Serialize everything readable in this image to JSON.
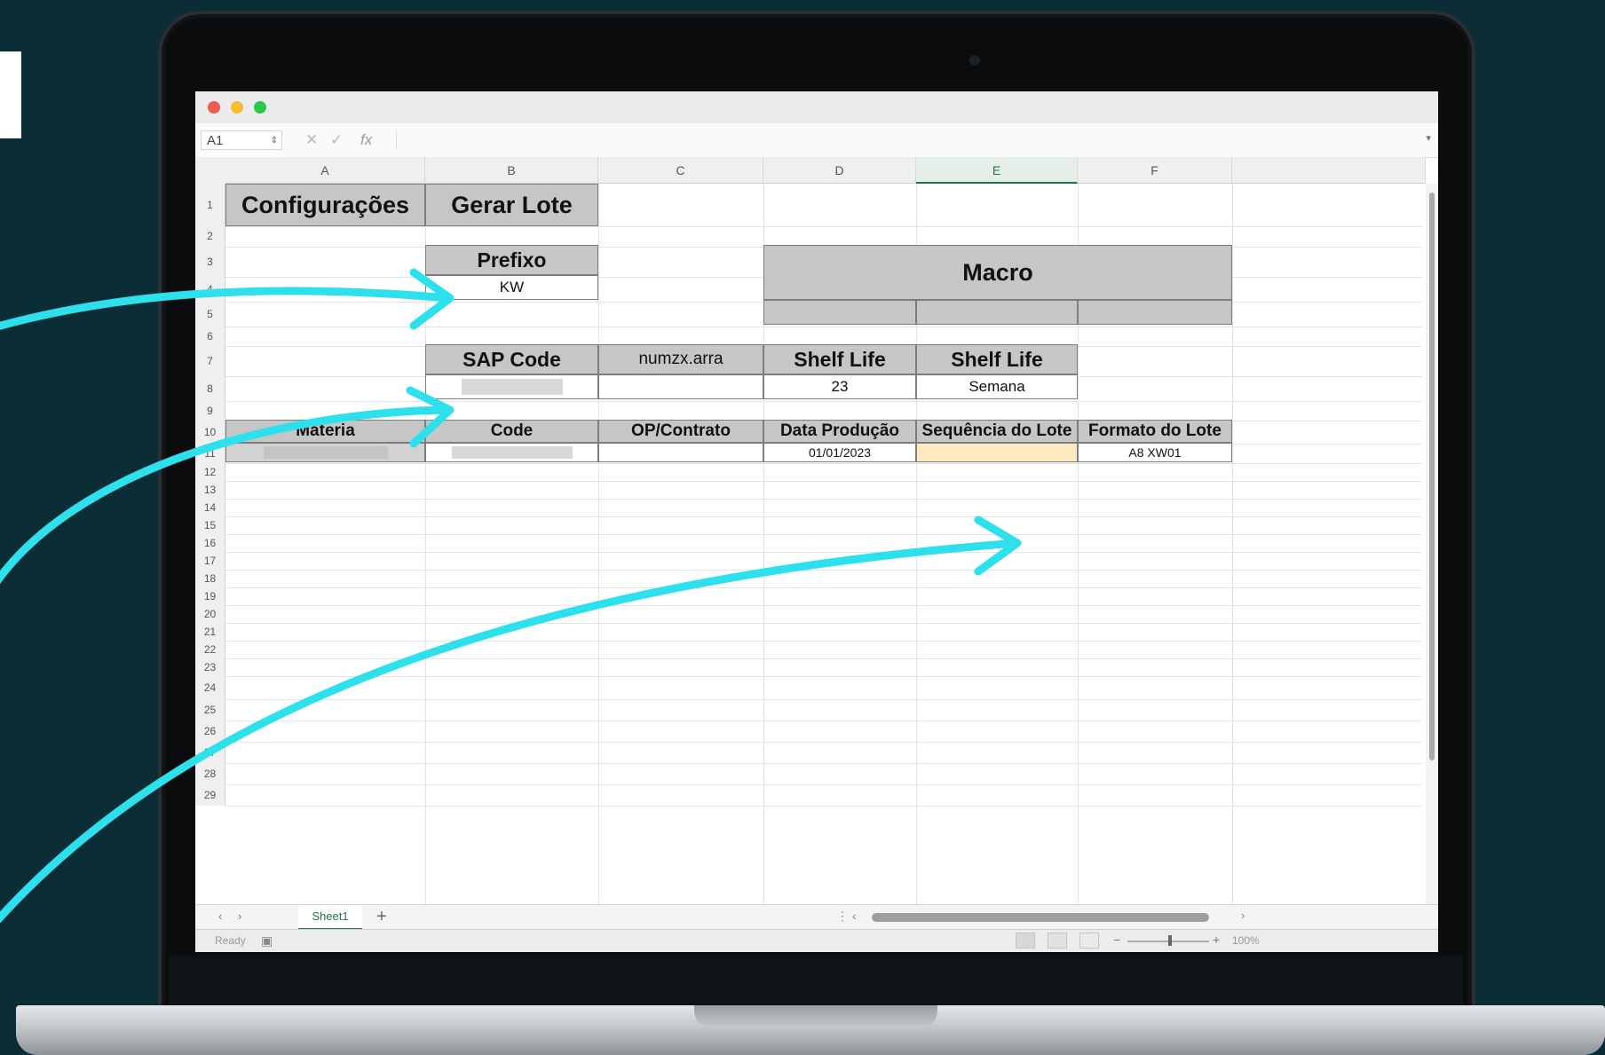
{
  "formula_bar": {
    "cell_ref": "A1",
    "cancel_icon": "✕",
    "enter_icon": "✓",
    "fx_label": "fx",
    "value": ""
  },
  "columns": [
    "A",
    "B",
    "C",
    "D",
    "E",
    "F"
  ],
  "rows": [
    "1",
    "2",
    "3",
    "4",
    "5",
    "6",
    "7",
    "8",
    "9",
    "10",
    "11",
    "12",
    "13",
    "14",
    "15",
    "16",
    "17",
    "18",
    "19",
    "20",
    "21",
    "22",
    "23",
    "24",
    "25",
    "26",
    "27",
    "28",
    "29"
  ],
  "sheet": {
    "configuracoes": "Configurações",
    "gerar_lote": "Gerar Lote",
    "prefixo_label": "Prefixo",
    "prefixo_value": "KW",
    "macro_label": "Macro",
    "sap_code_label": "SAP Code",
    "c7_label": "numzx.arra",
    "shelf_life_label_1": "Shelf Life",
    "shelf_life_label_2": "Shelf Life",
    "shelf_life_value": "23",
    "shelf_life_unit": "Semana",
    "table_headers": [
      "Materia",
      "Code",
      "OP/Contrato",
      "Data Produção",
      "Sequência do Lote",
      "Formato do Lote"
    ],
    "row11": {
      "data_producao": "01/01/2023",
      "formato_do_lote": "A8 XW01"
    }
  },
  "tabs": {
    "sheet_name": "Sheet1",
    "add_icon": "+"
  },
  "status": {
    "ready": "Ready",
    "zoom": "100%"
  },
  "colors": {
    "background": "#0b2d36",
    "arrow": "#2ee0ec",
    "header_fill": "#c6c6c6",
    "selected_cell": "#fde9c2",
    "excel_green": "#217346"
  }
}
